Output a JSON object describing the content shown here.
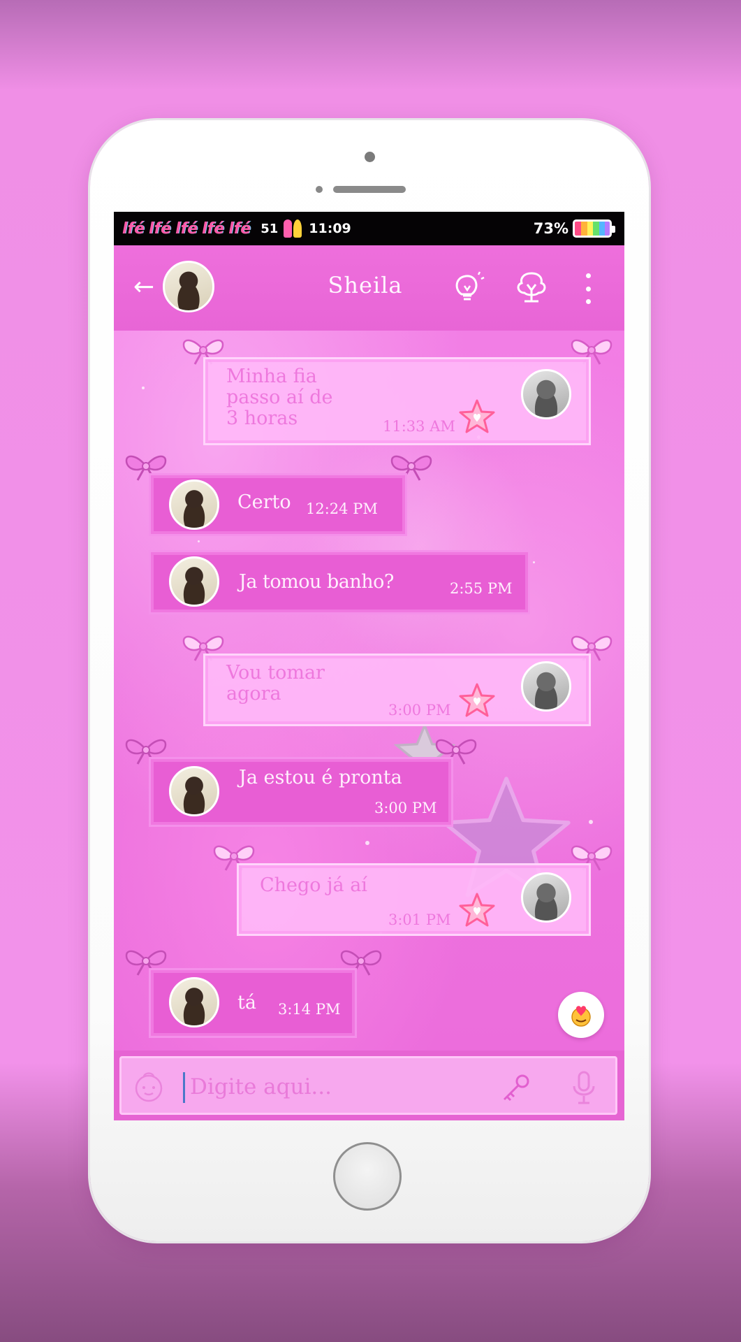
{
  "status_bar": {
    "notification_icons": [
      "lfé",
      "lfé",
      "lfé",
      "lfé",
      "lfé"
    ],
    "signal": "51",
    "time": "11:09",
    "battery": "73%"
  },
  "header": {
    "contact_name": "Sheila"
  },
  "messages": [
    {
      "direction": "out",
      "text": "Minha fia\npasso aí de\n3 horas",
      "time": "11:33 AM"
    },
    {
      "direction": "in",
      "text": "Certo",
      "time": "12:24 PM"
    },
    {
      "direction": "in",
      "text": "Ja tomou banho?",
      "time": "2:55 PM"
    },
    {
      "direction": "out",
      "text": "Vou tomar\nagora",
      "time": "3:00 PM"
    },
    {
      "direction": "in",
      "text": "Ja estou é pronta",
      "time": "3:00 PM"
    },
    {
      "direction": "out",
      "text": "Chego já aí",
      "time": "3:01 PM"
    },
    {
      "direction": "in",
      "text": "tá",
      "time": "3:14 PM"
    }
  ],
  "input": {
    "placeholder": "Digite aqui..."
  },
  "icons": {
    "back": "arrow-left-icon",
    "idea": "lightbulb-icon",
    "tree": "tree-icon",
    "menu": "more-vertical-icon",
    "emoji": "emoji-icon",
    "attach": "key-icon",
    "voice": "microphone-icon",
    "sticker": "baby-face-icon"
  },
  "colors": {
    "accent": "#e865d6",
    "outgoing_bubble": "#ffb9f8",
    "incoming_bubble": "#e85ed4"
  }
}
